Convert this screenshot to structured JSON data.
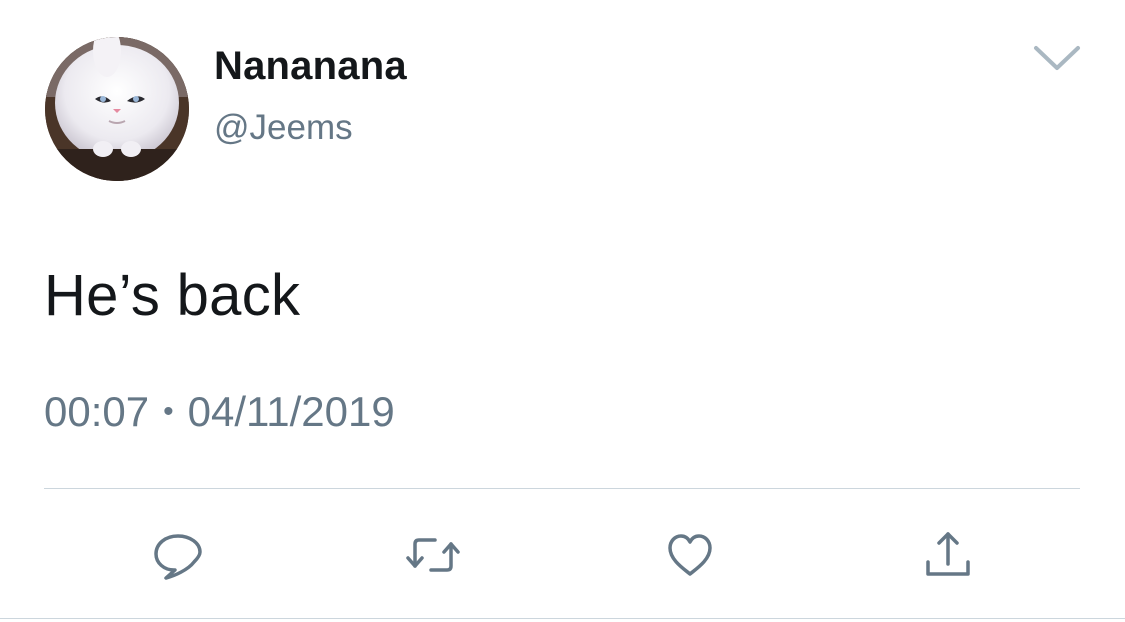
{
  "user": {
    "display_name": "Nananana",
    "handle": "@Jeems",
    "avatar": "white-cat-avatar"
  },
  "tweet": {
    "text": "He’s back",
    "time": "00:07",
    "separator": "•",
    "date": "04/11/2019"
  },
  "icons": {
    "menu": "chevron-down-icon",
    "reply": "reply-icon",
    "retweet": "retweet-icon",
    "like": "heart-icon",
    "share": "share-icon"
  },
  "colors": {
    "text_primary": "#14171a",
    "text_secondary": "#657786",
    "divider": "#ccd6dd",
    "icon": "#657786"
  }
}
